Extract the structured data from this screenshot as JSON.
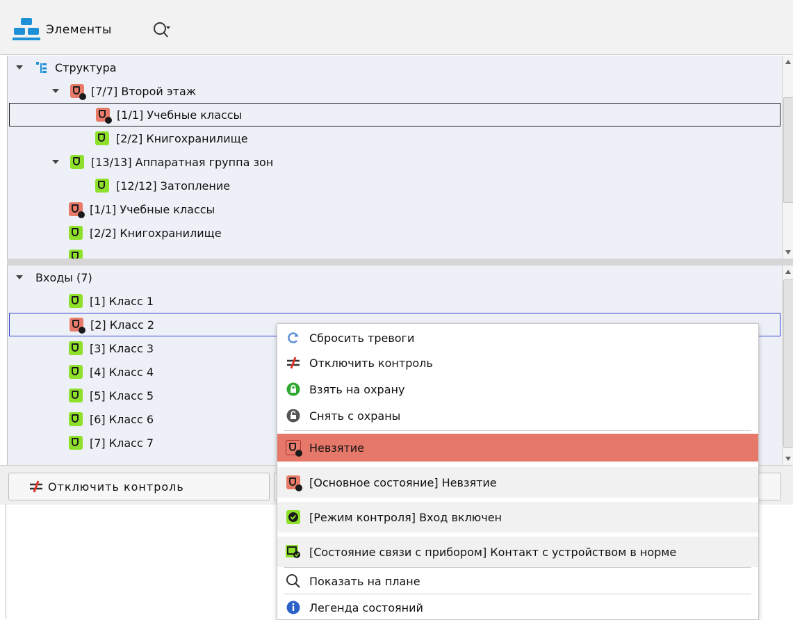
{
  "header": {
    "title": "Элементы"
  },
  "structure_tree": {
    "rows": [
      {
        "text": "Структура",
        "state": "structure"
      },
      {
        "text": "[7/7] Второй этаж",
        "state": "red"
      },
      {
        "text": "[1/1] Учебные классы",
        "state": "red"
      },
      {
        "text": "[2/2] Книгохранилище",
        "state": "green"
      },
      {
        "text": "[13/13] Аппаратная группа зон",
        "state": "green"
      },
      {
        "text": "[12/12] Затопление",
        "state": "green"
      },
      {
        "text": "[1/1] Учебные классы",
        "state": "red"
      },
      {
        "text": "[2/2] Книгохранилище",
        "state": "green"
      }
    ]
  },
  "inputs_tree": {
    "group_label": "Входы (7)",
    "rows": [
      {
        "text": "[1] Класс 1",
        "state": "green"
      },
      {
        "text": "[2] Класс 2",
        "state": "red"
      },
      {
        "text": "[3] Класс 3",
        "state": "green"
      },
      {
        "text": "[4] Класс 4",
        "state": "green"
      },
      {
        "text": "[5] Класс 5",
        "state": "green"
      },
      {
        "text": "[6] Класс 6",
        "state": "green"
      },
      {
        "text": "[7] Класс 7",
        "state": "green"
      }
    ]
  },
  "bottom_bar": {
    "disable_control_label": "Отключить контроль"
  },
  "context_menu": {
    "items": [
      {
        "label": "Сбросить тревоги",
        "icon": "reset-icon"
      },
      {
        "label": "Отключить контроль",
        "icon": "disable-control-icon"
      },
      {
        "label": "Взять на охрану",
        "icon": "lock-icon"
      },
      {
        "label": "Снять с охраны",
        "icon": "unlock-icon"
      }
    ],
    "highlighted": {
      "label": "Невзятие",
      "icon": "zone-alarm-icon"
    },
    "states": [
      {
        "label": "[Основное состояние] Невзятие"
      },
      {
        "label": "[Режим контроля] Вход включен"
      },
      {
        "label": "[Состояние связи с прибором] Контакт с устройством в норме"
      }
    ],
    "footer": [
      {
        "label": "Показать на плане",
        "icon": "search-icon"
      },
      {
        "label": "Легенда состояний",
        "icon": "info-icon"
      }
    ]
  },
  "colors": {
    "ok": "#8ee02a",
    "alarm": "#e87a6a",
    "highlight": "#e6786a",
    "tree_bg": "#eef0f8"
  }
}
